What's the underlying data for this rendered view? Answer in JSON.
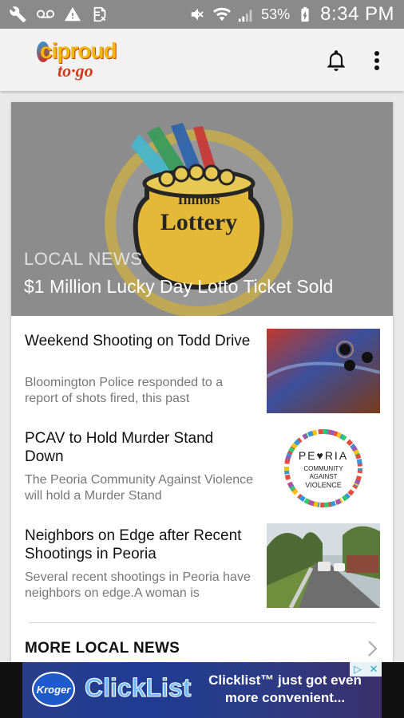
{
  "status_bar": {
    "icons": [
      "wrench-icon",
      "voicemail-icon",
      "warning-icon",
      "sim-off-icon",
      "mute-icon",
      "wifi-icon",
      "signal-icon",
      "battery-charging-icon"
    ],
    "battery_percent": "53%",
    "time": "8:34 PM"
  },
  "app_bar": {
    "logo_text_top": "ciproud",
    "logo_text_bottom": "to·go",
    "actions": [
      "bell-icon",
      "more-vert-icon"
    ]
  },
  "hero": {
    "image_text_1": "Illinois",
    "image_text_2": "Lottery",
    "category": "LOCAL NEWS",
    "title": "$1 Million Lucky Day Lotto Ticket Sold"
  },
  "stories": [
    {
      "title": "Weekend Shooting on Todd Drive",
      "snippet": "Bloomington Police responded to a report of shots fired, this past"
    },
    {
      "title": "PCAV to Hold Murder Stand Down",
      "snippet": "The Peoria Community Against Violence will hold a Murder Stand",
      "thumb_text": [
        "PE♥RIA",
        "COMMUNITY",
        "AGAINST",
        "VIOLENCE"
      ]
    },
    {
      "title": "Neighbors on Edge after Recent Shootings in Peoria",
      "snippet": "Several recent shootings in Peoria have neighbors on edge.A woman is"
    }
  ],
  "more_link": "MORE LOCAL NEWS",
  "ad": {
    "brand": "Kroger",
    "product": "ClickList",
    "copy": "Clicklist™ just got even more convenient...",
    "badge": [
      "▷",
      "✕"
    ]
  }
}
